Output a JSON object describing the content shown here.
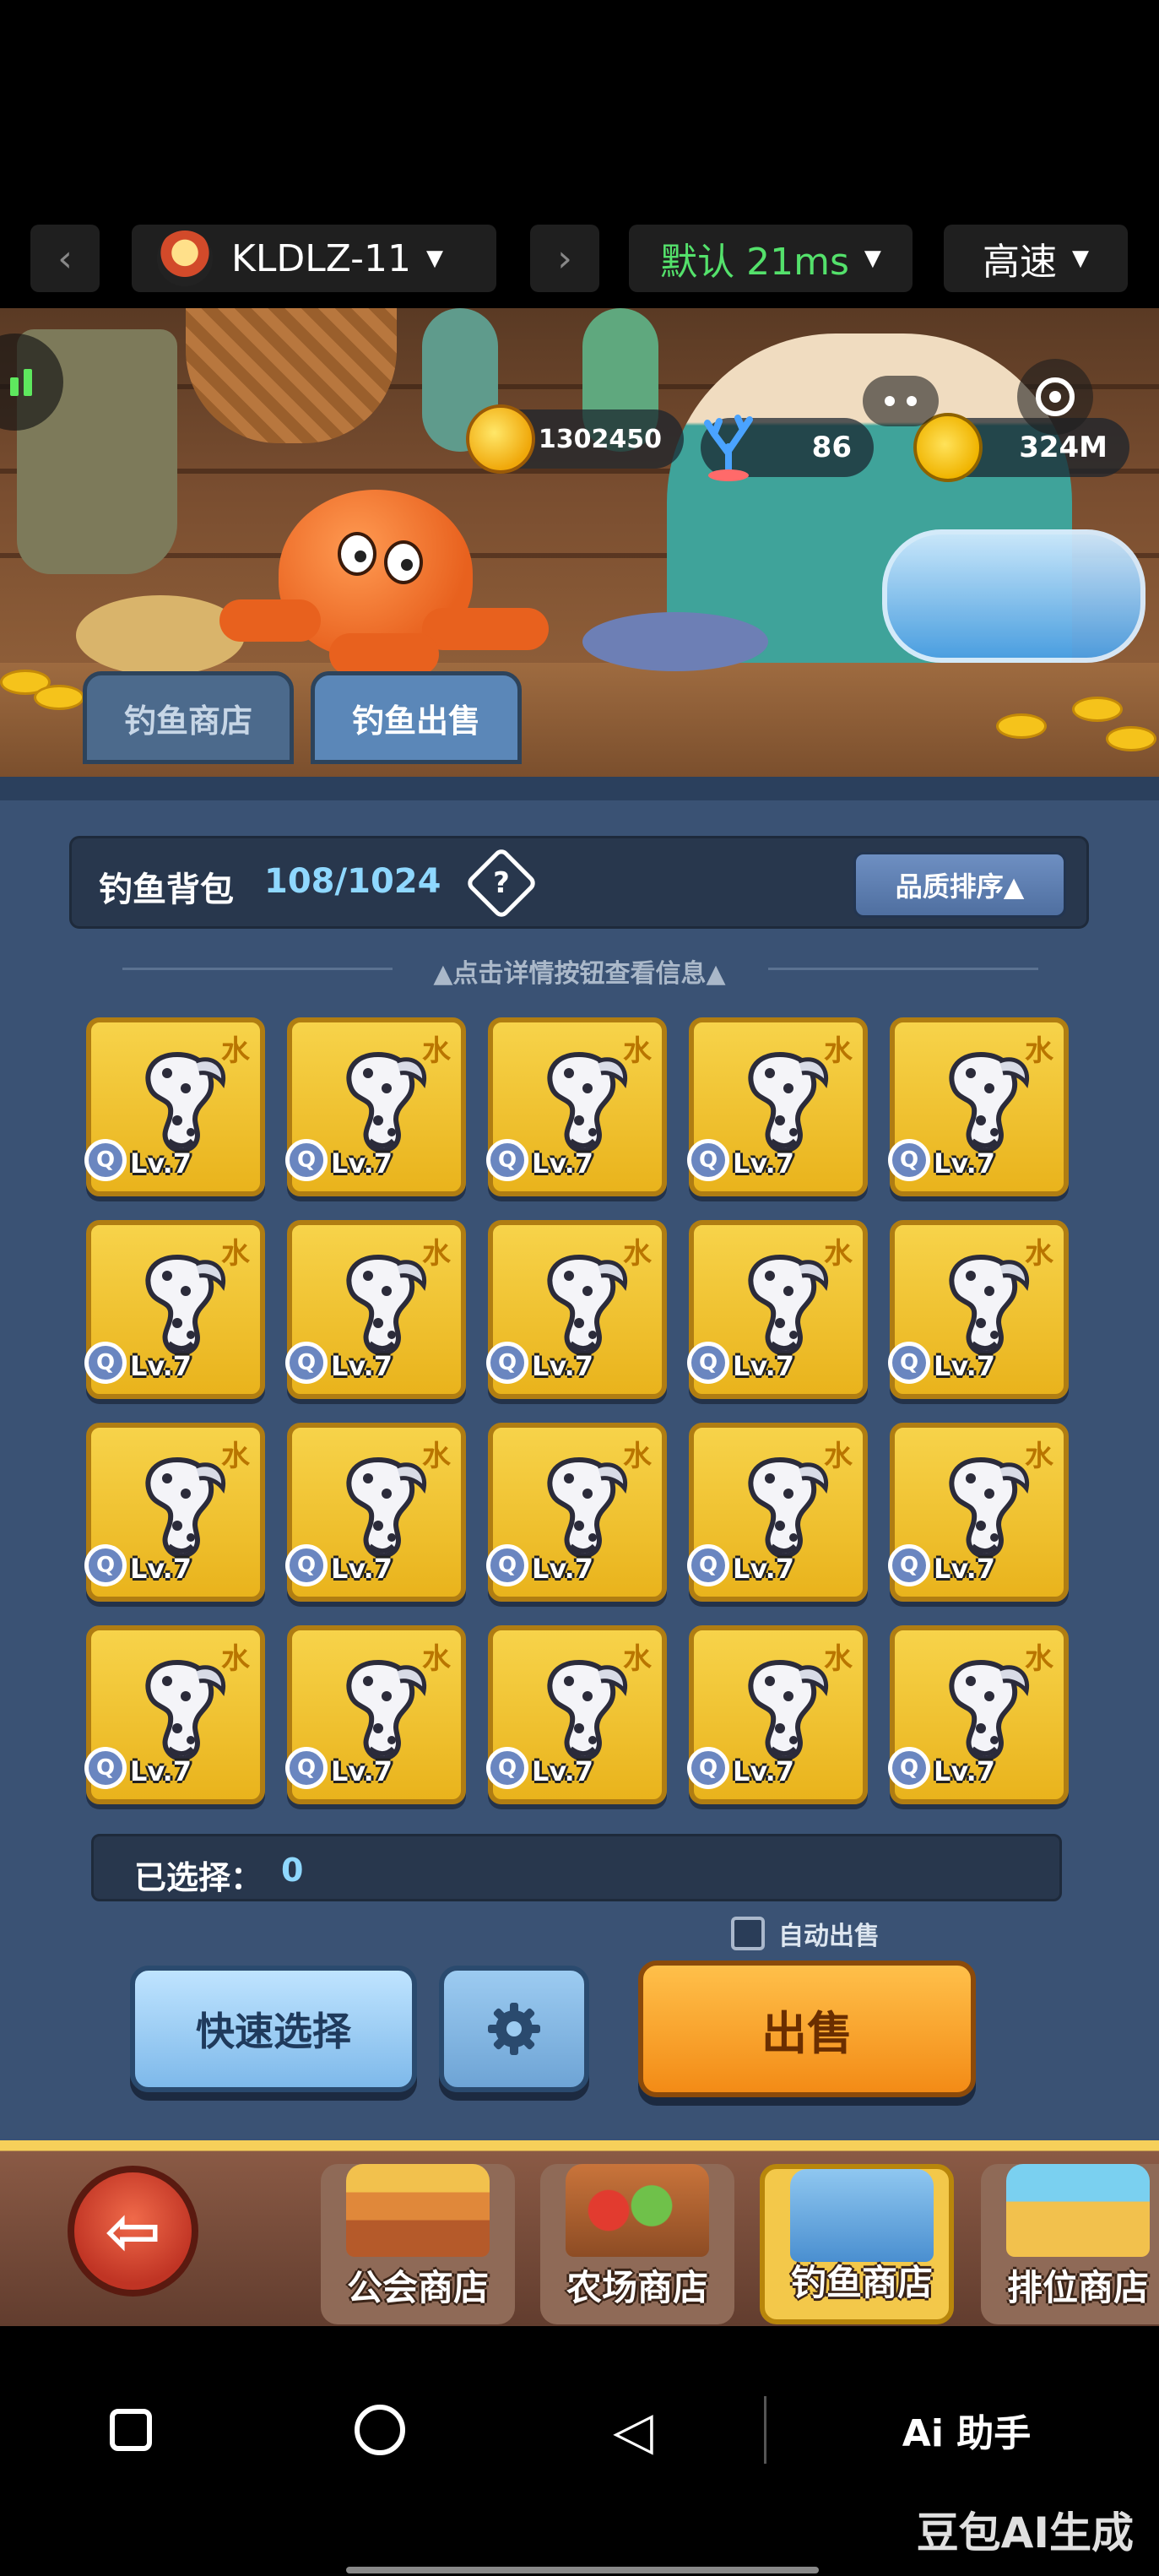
{
  "topbar": {
    "prev_icon": "chevron-left-icon",
    "device_name": "KLDLZ-11",
    "next_icon": "chevron-right-icon",
    "mode": "默认 21ms",
    "speed": "高速",
    "mode_color": "#54e16b"
  },
  "currencies": {
    "gold": "1302450",
    "coral": "86",
    "star": "324M"
  },
  "tabs": [
    {
      "label": "钓鱼商店",
      "active": false
    },
    {
      "label": "钓鱼出售",
      "active": true
    }
  ],
  "bag": {
    "label": "钓鱼背包",
    "count": "108/1024",
    "help_icon": "?",
    "sort_label": "品质排序▲"
  },
  "hint": "点击详情按钮查看信息",
  "items": [
    {
      "element": "水",
      "quality": "Q",
      "level": "Lv.7"
    },
    {
      "element": "水",
      "quality": "Q",
      "level": "Lv.7"
    },
    {
      "element": "水",
      "quality": "Q",
      "level": "Lv.7"
    },
    {
      "element": "水",
      "quality": "Q",
      "level": "Lv.7"
    },
    {
      "element": "水",
      "quality": "Q",
      "level": "Lv.7"
    },
    {
      "element": "水",
      "quality": "Q",
      "level": "Lv.7"
    },
    {
      "element": "水",
      "quality": "Q",
      "level": "Lv.7"
    },
    {
      "element": "水",
      "quality": "Q",
      "level": "Lv.7"
    },
    {
      "element": "水",
      "quality": "Q",
      "level": "Lv.7"
    },
    {
      "element": "水",
      "quality": "Q",
      "level": "Lv.7"
    },
    {
      "element": "水",
      "quality": "Q",
      "level": "Lv.7"
    },
    {
      "element": "水",
      "quality": "Q",
      "level": "Lv.7"
    },
    {
      "element": "水",
      "quality": "Q",
      "level": "Lv.7"
    },
    {
      "element": "水",
      "quality": "Q",
      "level": "Lv.7"
    },
    {
      "element": "水",
      "quality": "Q",
      "level": "Lv.7"
    },
    {
      "element": "水",
      "quality": "Q",
      "level": "Lv.7"
    },
    {
      "element": "水",
      "quality": "Q",
      "level": "Lv.7"
    },
    {
      "element": "水",
      "quality": "Q",
      "level": "Lv.7"
    },
    {
      "element": "水",
      "quality": "Q",
      "level": "Lv.7"
    },
    {
      "element": "水",
      "quality": "Q",
      "level": "Lv.7"
    }
  ],
  "selected": {
    "label": "已选择：",
    "value": "0"
  },
  "auto_sell": {
    "label": "自动出售",
    "checked": false
  },
  "actions": {
    "quick_select": "快速选择",
    "settings_icon": "gear-icon",
    "sell": "出售"
  },
  "nav": {
    "back_icon": "back-arrow-icon",
    "items": [
      {
        "label": "公会商店"
      },
      {
        "label": "农场商店"
      },
      {
        "label": "钓鱼商店",
        "active": true
      },
      {
        "label": "排位商店"
      }
    ]
  },
  "system": {
    "ai_label": "Ai 助手",
    "watermark": "豆包AI生成"
  }
}
